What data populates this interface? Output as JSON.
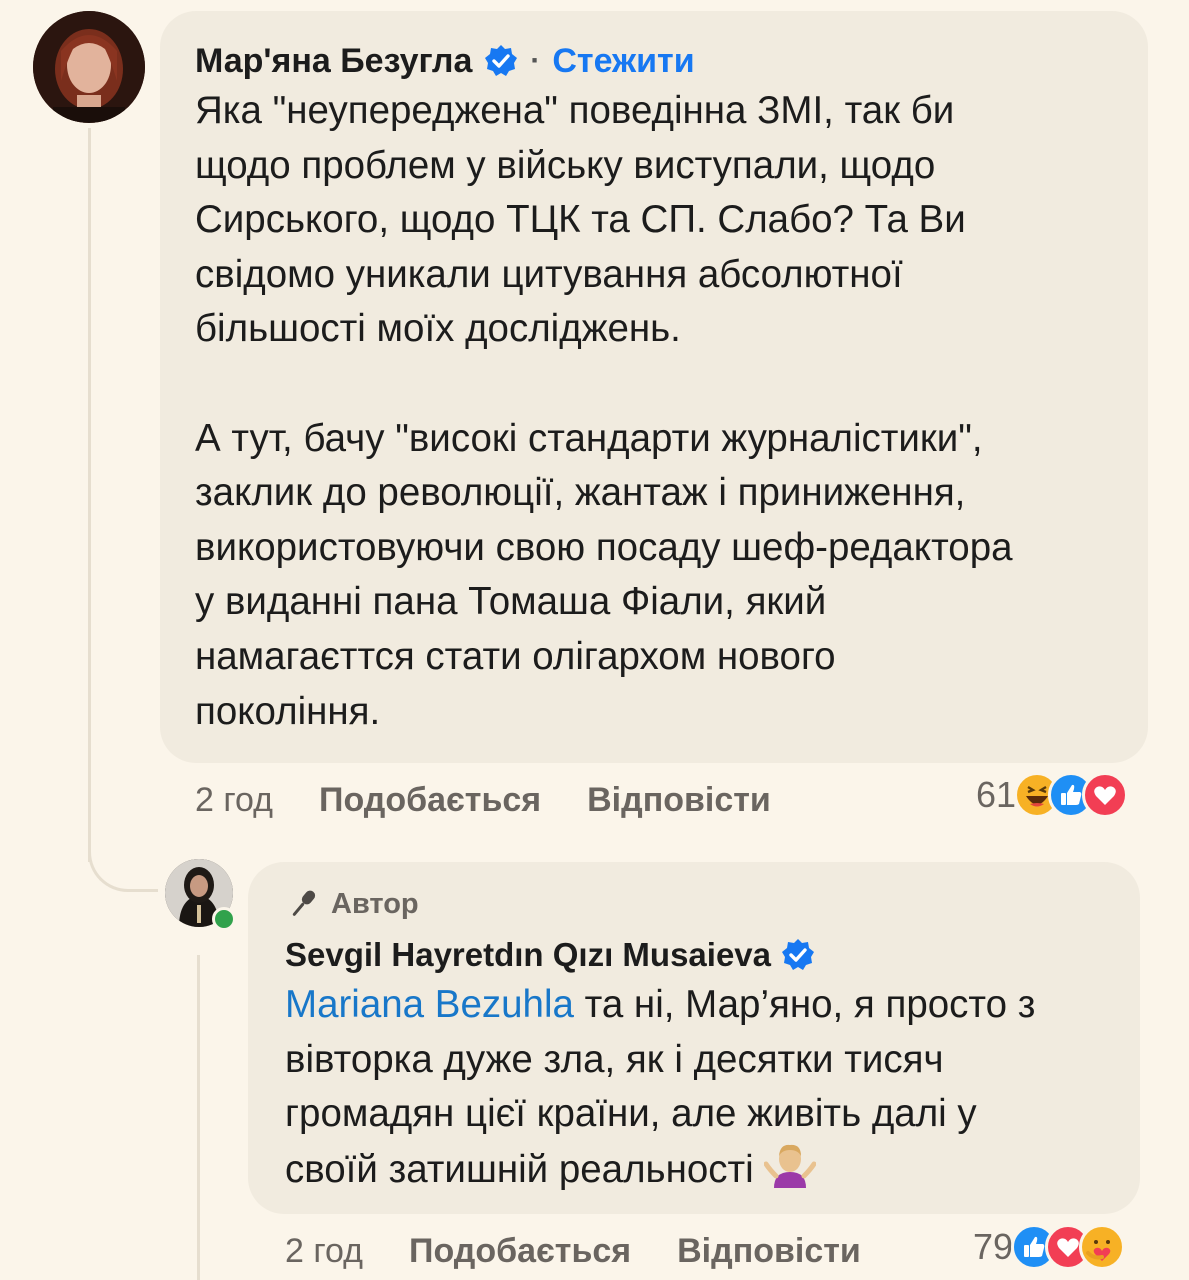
{
  "comment": {
    "author_name": "Мар'яна Безугла",
    "separator": "·",
    "follow_label": "Стежити",
    "text_paragraph_1": "Яка \"неупереджена\" поведінна ЗМІ, так би\nщодо проблем у війську виступали, щодо\nСирського, щодо ТЦК та СП. Слабо? Та Ви\nсвідомо уникали цитування абсолютної\nбільшості моїх досліджень.",
    "text_paragraph_2": "А тут, бачу \"високі стандарти журналістики\",\nзаклик до революції, жантаж і приниження,\nвикористовуючи свою посаду шеф-редактора\nу виданні пана Томаша Фіали, який\nнамагаєттся стати олігархом нового\nпокоління.",
    "time": "2 год",
    "like_label": "Подобається",
    "reply_label": "Відповісти",
    "reaction_count": "61",
    "reactions": [
      "haha-icon",
      "like-icon",
      "love-icon"
    ]
  },
  "reply": {
    "badge_label": "Автор",
    "author_name": "Sevgil Hayretdın Qızı Musaieva",
    "mention": "Mariana Bezuhla",
    "text_line_1": " та ні, Мар’яно, я просто з",
    "text_rest": "вівторка дуже зла, як і десятки тисяч\nгромадян цієї країни, але живіть далі у\nсвоїй затишній реальності",
    "time": "2 год",
    "like_label": "Подобається",
    "reply_label": "Відповісти",
    "reaction_count": "79",
    "reactions": [
      "like-icon",
      "love-icon",
      "care-icon"
    ]
  },
  "colors": {
    "background": "#fbf5ea",
    "bubble": "#f1ebdf",
    "link_blue": "#1778f2",
    "mention_blue": "#1877c9",
    "muted_text": "#6a6560",
    "online_green": "#31a24c"
  }
}
